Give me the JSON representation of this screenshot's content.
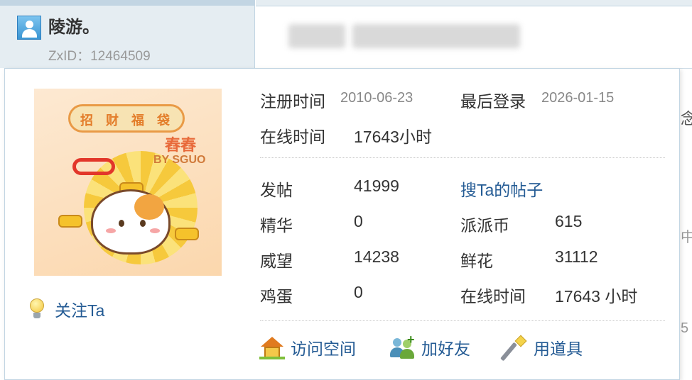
{
  "author": {
    "name": "陵游。",
    "id_label": "ZxID：",
    "id_value": "12464509"
  },
  "popup": {
    "avatar_art": {
      "ribbon_chars": [
        "招",
        "财",
        "福",
        "袋"
      ],
      "label_top": "舂舂",
      "label_bottom": "BY SGUO"
    },
    "follow_label": "关注Ta",
    "register_label": "注册时间",
    "register_value": "2010-06-23",
    "last_login_label": "最后登录",
    "last_login_value": "2026-01-15",
    "online_label": "在线时间",
    "online_value": "17643小时",
    "search_posts_link": "搜Ta的帖子",
    "stats": {
      "posts_label": "发帖",
      "posts_value": "41999",
      "digest_label": "精华",
      "digest_value": "0",
      "prestige_label": "威望",
      "prestige_value": "14238",
      "eggs_label": "鸡蛋",
      "eggs_value": "0",
      "coins_label": "派派币",
      "coins_value": "615",
      "flowers_label": "鲜花",
      "flowers_value": "31112",
      "online2_label": "在线时间",
      "online2_value": "17643 小时"
    },
    "actions": {
      "visit_space": "访问空间",
      "add_friend": "加好友",
      "use_item": "用道具"
    }
  },
  "background_fragments": {
    "right_edge_1": "念",
    "right_edge_2": "中",
    "right_edge_3": "5"
  },
  "colors": {
    "link": "#245b94",
    "panel_bg": "#e5edf2",
    "border": "#c2d5e3"
  }
}
